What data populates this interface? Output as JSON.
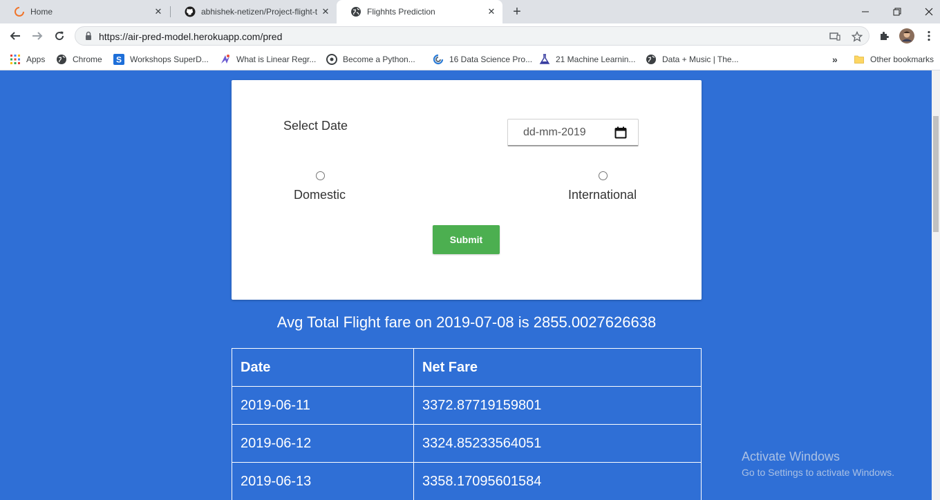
{
  "browser": {
    "tabs": [
      {
        "title": "Home",
        "icon": "loading-ring-icon"
      },
      {
        "title": "abhishek-netizen/Project-flight-t",
        "icon": "github-icon"
      },
      {
        "title": "Flighhts Prediction",
        "icon": "globe-icon"
      }
    ],
    "url": "https://air-pred-model.herokuapp.com/pred",
    "bookmarks": [
      {
        "label": "Apps",
        "icon": "apps-grid-icon"
      },
      {
        "label": "Chrome",
        "icon": "globe-icon"
      },
      {
        "label": "Workshops SuperD...",
        "icon": "s-logo-icon"
      },
      {
        "label": "What is Linear Regr...",
        "icon": "brand-icon"
      },
      {
        "label": "Become a Python...",
        "icon": "python-icon"
      },
      {
        "label": "16 Data Science Pro...",
        "icon": "spiral-icon"
      },
      {
        "label": "21 Machine Learnin...",
        "icon": "flask-icon"
      },
      {
        "label": "Data + Music | The...",
        "icon": "globe-icon"
      }
    ],
    "other_bookmarks": "Other bookmarks",
    "overflow_label": "»"
  },
  "form": {
    "select_date_label": "Select Date",
    "date_value": "dd-mm-2019",
    "radio_domestic": "Domestic",
    "radio_international": "International",
    "submit_label": "Submit"
  },
  "result_text": "Avg Total Flight fare on 2019-07-08 is 2855.0027626638",
  "table": {
    "headers": [
      "Date",
      "Net Fare"
    ],
    "rows": [
      [
        "2019-06-11",
        "3372.87719159801"
      ],
      [
        "2019-06-12",
        "3324.85233564051"
      ],
      [
        "2019-06-13",
        "3358.17095601584"
      ]
    ]
  },
  "watermark": {
    "line1": "Activate Windows",
    "line2": "Go to Settings to activate Windows."
  },
  "colors": {
    "page_background": "#2f6fd6",
    "submit_button": "#4caf50"
  }
}
